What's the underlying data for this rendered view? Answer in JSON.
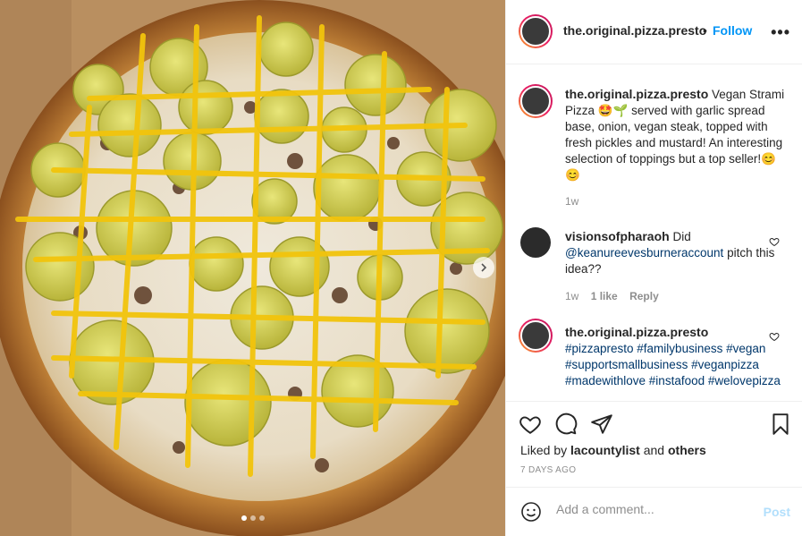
{
  "media": {
    "image_description_icon": "pizza-photo",
    "carousel_dots": 3,
    "active_dot": 0
  },
  "header": {
    "username": "the.original.pizza.presto",
    "separator": "•",
    "follow_label": "Follow",
    "more_icon": "more-icon",
    "more_label": "•••"
  },
  "caption": {
    "username": "the.original.pizza.presto",
    "text": "Vegan Strami Pizza 🤩🌱 served with garlic spread base, onion, vegan steak, topped with fresh pickles and mustard! An interesting selection of toppings but a top seller!😊😊",
    "time": "1w"
  },
  "comments": [
    {
      "username": "visionsofpharaoh",
      "text_before": "Did",
      "mention": "@keanureevesburneraccount",
      "text_after": "pitch this idea??",
      "time": "1w",
      "likes": "1 like",
      "reply": "Reply"
    },
    {
      "username": "the.original.pizza.presto",
      "hashtags": "#pizzapresto #familybusiness #vegan #supportsmallbusiness #veganpizza #madewithlove #instafood #welovepizza"
    }
  ],
  "actions": {
    "liked_by_prefix": "Liked by",
    "liked_by_user": "lacountylist",
    "liked_by_and": "and",
    "liked_by_others": "others",
    "date": "7 DAYS AGO"
  },
  "add_comment": {
    "placeholder": "Add a comment...",
    "post_label": "Post"
  },
  "colors": {
    "link": "#0095f6",
    "hashtag": "#00376b",
    "muted": "#8e8e8e",
    "post_disabled": "#b2dffc"
  }
}
